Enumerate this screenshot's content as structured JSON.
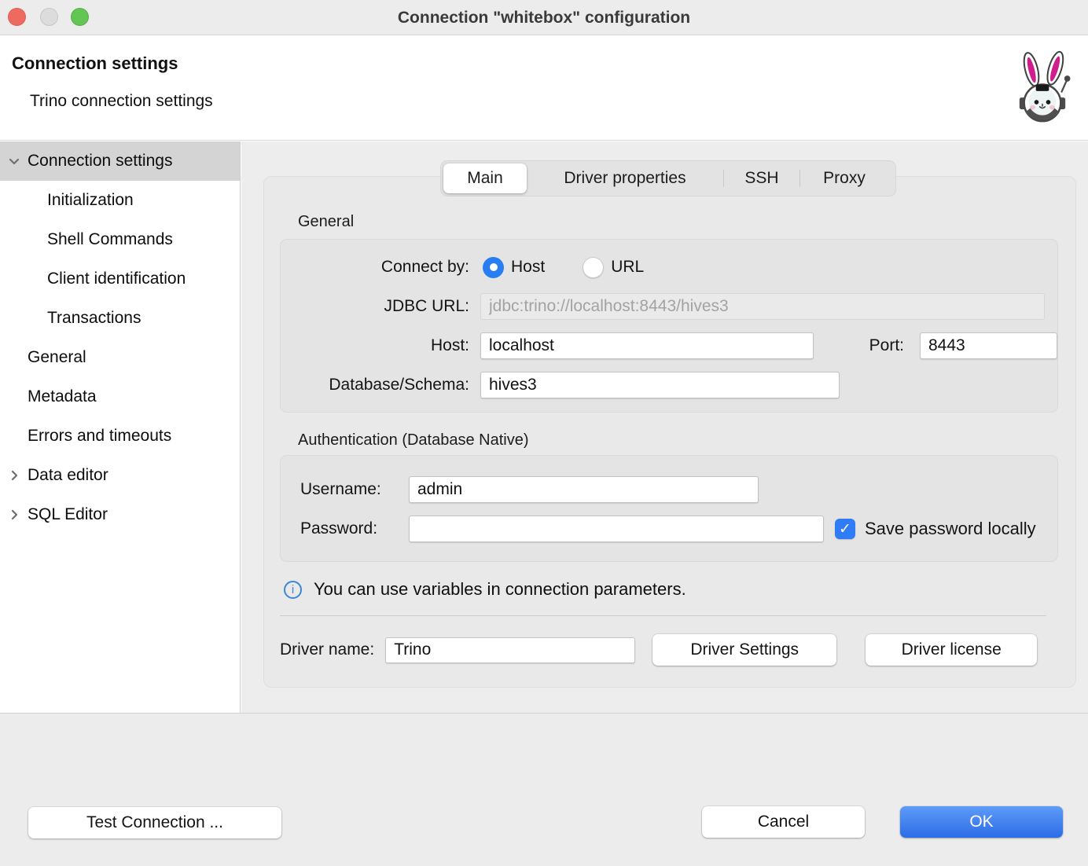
{
  "window": {
    "title": "Connection \"whitebox\" configuration"
  },
  "header": {
    "title": "Connection settings",
    "subtitle": "Trino connection settings"
  },
  "sidebar": {
    "items": [
      {
        "label": "Connection settings",
        "level": 0,
        "chevron": "down",
        "selected": true
      },
      {
        "label": "Initialization",
        "level": 1
      },
      {
        "label": "Shell Commands",
        "level": 1
      },
      {
        "label": "Client identification",
        "level": 1
      },
      {
        "label": "Transactions",
        "level": 1
      },
      {
        "label": "General",
        "level": 0
      },
      {
        "label": "Metadata",
        "level": 0
      },
      {
        "label": "Errors and timeouts",
        "level": 0
      },
      {
        "label": "Data editor",
        "level": 0,
        "chevron": "right"
      },
      {
        "label": "SQL Editor",
        "level": 0,
        "chevron": "right"
      }
    ]
  },
  "tabs": [
    {
      "label": "Main",
      "selected": true
    },
    {
      "label": "Driver properties",
      "selected": false
    },
    {
      "label": "SSH",
      "selected": false
    },
    {
      "label": "Proxy",
      "selected": false
    }
  ],
  "general_section": {
    "title": "General",
    "connect_by_label": "Connect by:",
    "host_radio_label": "Host",
    "url_radio_label": "URL",
    "host_radio_selected": true,
    "jdbc_url_label": "JDBC URL:",
    "jdbc_url_value": "jdbc:trino://localhost:8443/hives3",
    "host_label": "Host:",
    "host_value": "localhost",
    "port_label": "Port:",
    "port_value": "8443",
    "database_label": "Database/Schema:",
    "database_value": "hives3"
  },
  "auth_section": {
    "title": "Authentication (Database Native)",
    "username_label": "Username:",
    "username_value": "admin",
    "password_label": "Password:",
    "password_value": "",
    "save_password_label": "Save password locally",
    "save_password_checked": true
  },
  "info_text": "You can use variables in connection parameters.",
  "driver": {
    "name_label": "Driver name:",
    "name_value": "Trino",
    "settings_button": "Driver Settings",
    "license_button": "Driver license"
  },
  "footer": {
    "test_button": "Test Connection ...",
    "cancel_button": "Cancel",
    "ok_button": "OK"
  },
  "icons": {
    "info_glyph": "i",
    "checkmark_glyph": "✓"
  },
  "colors": {
    "accent_blue": "#2c7bf2",
    "selected_row": "#d4d4d4",
    "panel_bg": "#e9e9e9",
    "group_bg": "#e4e4e4",
    "titlebar_bg": "#ececec",
    "traffic_red": "#ee6a5f",
    "traffic_gray": "#dcdcdc",
    "traffic_green": "#62c554",
    "logo_pink": "#cf1d8d"
  }
}
